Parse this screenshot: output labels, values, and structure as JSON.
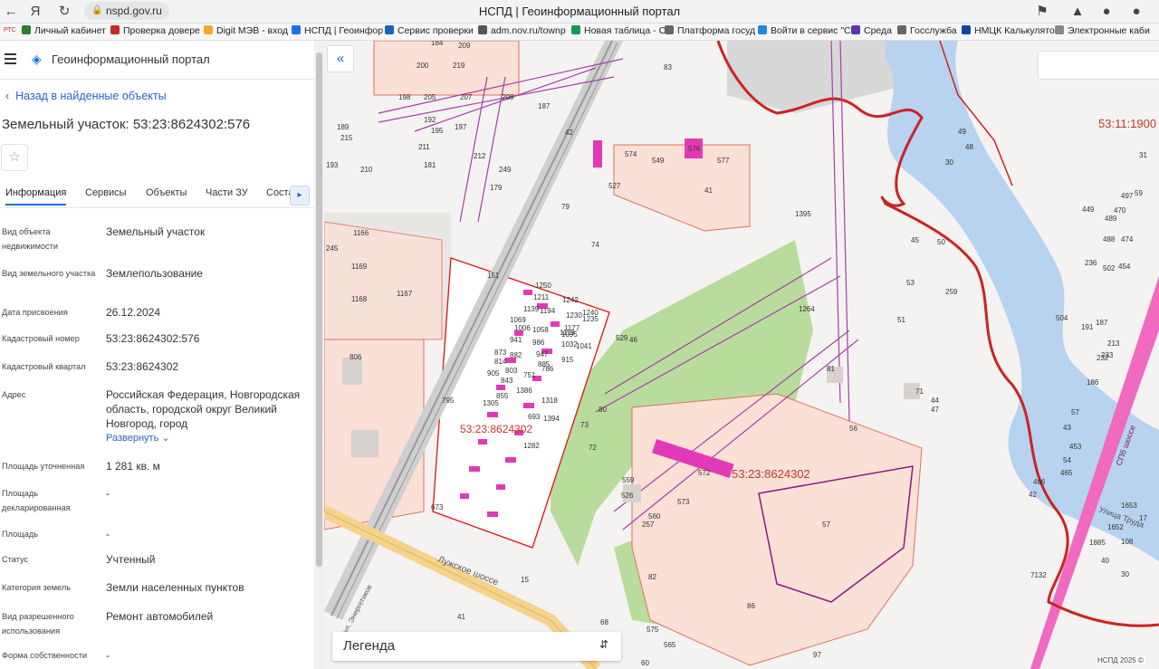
{
  "browser": {
    "tab_title": "НСПД | Геоинформационный портал",
    "url": "nspd.gov.ru",
    "bookmarks": [
      {
        "label": "Личный кабинет",
        "color": "#2e7d32"
      },
      {
        "label": "Проверка довере",
        "color": "#c62828"
      },
      {
        "label": "Digit МЭВ - вход",
        "color": "#f9a825"
      },
      {
        "label": "НСПД | Геоинфор",
        "color": "#1a73e8"
      },
      {
        "label": "Сервис проверки",
        "color": "#1565c0"
      },
      {
        "label": "adm.nov.ru/townp",
        "color": "#555555"
      },
      {
        "label": "Новая таблица - С",
        "color": "#0f9d58"
      },
      {
        "label": "Платформа госуд",
        "color": "#666666"
      },
      {
        "label": "Войти в сервис \"С",
        "color": "#1e88e5"
      },
      {
        "label": "Среда",
        "color": "#5e35b1"
      },
      {
        "label": "Госслужба",
        "color": "#666666"
      },
      {
        "label": "НМЦК Калькулято",
        "color": "#0d47a1"
      },
      {
        "label": "Электронные каби",
        "color": "#888888"
      }
    ],
    "bookmark_prefix": "РТС"
  },
  "app": {
    "title": "Геоинформационный портал",
    "back_label": "Назад в найденные объекты",
    "page_title": "Земельный участок: 53:23:8624302:576",
    "tabs": [
      "Информация",
      "Сервисы",
      "Объекты",
      "Части ЗУ",
      "Соста"
    ],
    "fields": [
      {
        "label": "Вид объекта недвижимости",
        "value": "Земельный участок"
      },
      {
        "label": "Вид земельного участка",
        "value": "Землепользование"
      },
      {
        "label": "Дата присвоения",
        "value": "26.12.2024"
      },
      {
        "label": "Кадастровый номер",
        "value": "53:23:8624302:576"
      },
      {
        "label": "Кадастровый квартал",
        "value": "53:23:8624302"
      },
      {
        "label": "Адрес",
        "value": "Российская Федерация, Новгородская область, городской округ Великий Новгород, город"
      },
      {
        "label": "Площадь уточненная",
        "value": "1 281 кв. м"
      },
      {
        "label": "Площадь декларированная",
        "value": "-"
      },
      {
        "label": "Площадь",
        "value": "-"
      },
      {
        "label": "Статус",
        "value": "Учтенный"
      },
      {
        "label": "Категория земель",
        "value": "Земли населенных пунктов"
      },
      {
        "label": "Вид разрешенного использования",
        "value": "Ремонт автомобилей"
      },
      {
        "label": "Форма собственности",
        "value": "-"
      }
    ],
    "expand_label": "Развернуть"
  },
  "map": {
    "legend_label": "Легенда",
    "copyright": "НСПД 2025 ©",
    "quarter_labels": [
      "53:23:8624302",
      "53:11:1900",
      "53:23:8624302"
    ],
    "road_labels": [
      "Лужское шоссе",
      "ул. Энергетиков",
      "Улица Труда",
      "СПб шоссе"
    ],
    "parcel_numbers": [
      "184",
      "209",
      "200",
      "219",
      "198",
      "205",
      "207",
      "208",
      "187",
      "192",
      "195",
      "197",
      "189",
      "215",
      "193",
      "210",
      "211",
      "181",
      "212",
      "179",
      "249",
      "42",
      "83",
      "245",
      "1166",
      "1169",
      "1168",
      "1167",
      "806",
      "151",
      "79",
      "74",
      "574",
      "549",
      "576",
      "577",
      "527",
      "41",
      "1250",
      "1211",
      "1242",
      "1139",
      "1194",
      "1230",
      "1240",
      "1069",
      "1006",
      "1058",
      "1119",
      "1235",
      "1177",
      "941",
      "986",
      "1095",
      "1041",
      "873",
      "882",
      "947",
      "1032",
      "814",
      "803",
      "885",
      "915",
      "905",
      "751",
      "786",
      "855",
      "843",
      "1386",
      "795",
      "1318",
      "1394",
      "693",
      "1305",
      "1282",
      "673",
      "1264",
      "1395",
      "529",
      "46",
      "80",
      "73",
      "72",
      "81",
      "71",
      "45",
      "50",
      "53",
      "259",
      "51",
      "44",
      "47",
      "49",
      "48",
      "30",
      "31",
      "59",
      "497",
      "449",
      "489",
      "470",
      "474",
      "488",
      "454",
      "236",
      "502",
      "504",
      "191",
      "187",
      "213",
      "233",
      "232",
      "186",
      "57",
      "43",
      "453",
      "54",
      "465",
      "466",
      "42",
      "1653",
      "17",
      "1652",
      "108",
      "1885",
      "30",
      "7132",
      "40",
      "572",
      "559",
      "526",
      "573",
      "560",
      "257",
      "56",
      "57",
      "82",
      "15",
      "68",
      "575",
      "565",
      "60",
      "86",
      "97",
      "41"
    ]
  }
}
